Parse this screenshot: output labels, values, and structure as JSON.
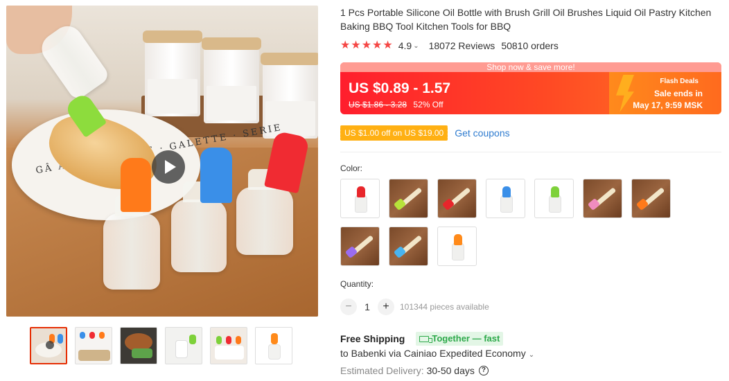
{
  "product": {
    "title": "1 Pcs Portable Silicone Oil Bottle with Brush Grill Oil Brushes Liquid Oil Pastry Kitchen Baking BBQ Tool Kitchen Tools for BBQ",
    "rating": "4.9",
    "reviews": "18072 Reviews",
    "orders": "50810 orders"
  },
  "gallery": {
    "plate_text": "GÂ AUX NO  ·  VOIE  ·  GALETTE  ·  SERIE",
    "thumbnails": [
      "video-preview",
      "bottles-trio",
      "grill-food",
      "single-bottle",
      "three-bottles",
      "orange-bottle"
    ]
  },
  "price": {
    "banner_top": "Shop now & save more!",
    "current": "US $0.89 - 1.57",
    "original": "US $1.86 - 3.28",
    "discount": "52% Off",
    "flash_title": "Flash Deals",
    "flash_line1": "Sale ends in",
    "flash_line2": "May 17, 9:59 MSK"
  },
  "coupon": {
    "tag": "US $1.00 off on US $19.00",
    "link": "Get coupons"
  },
  "color": {
    "label": "Color:",
    "options": [
      {
        "kind": "bottle",
        "brush_color": "#e8262b"
      },
      {
        "kind": "wood",
        "head_color": "#b7e23a"
      },
      {
        "kind": "wood",
        "head_color": "#e8262b"
      },
      {
        "kind": "bottle",
        "brush_color": "#3a8fe8"
      },
      {
        "kind": "bottle",
        "brush_color": "#7ed13a"
      },
      {
        "kind": "wood",
        "head_color": "#f08cc0"
      },
      {
        "kind": "wood",
        "head_color": "#ff7a1a"
      },
      {
        "kind": "wood",
        "head_color": "#9a6cf0"
      },
      {
        "kind": "wood",
        "head_color": "#48b4f0"
      },
      {
        "kind": "bottle",
        "brush_color": "#ff8a1a"
      }
    ]
  },
  "quantity": {
    "label": "Quantity:",
    "minus": "−",
    "value": "1",
    "plus": "+",
    "available": "101344 pieces available"
  },
  "shipping": {
    "title": "Free Shipping",
    "badge": "Together — fast",
    "to": "to Babenki via Cainiao Expedited Economy",
    "delivery_label": "Estimated Delivery:",
    "delivery_days": "30-50 days",
    "help": "?"
  },
  "colors": {
    "accent": "#e62e04",
    "star": "#f54745",
    "link": "#2e7bcf",
    "coupon": "#ffb013",
    "green": "#2da94a"
  }
}
